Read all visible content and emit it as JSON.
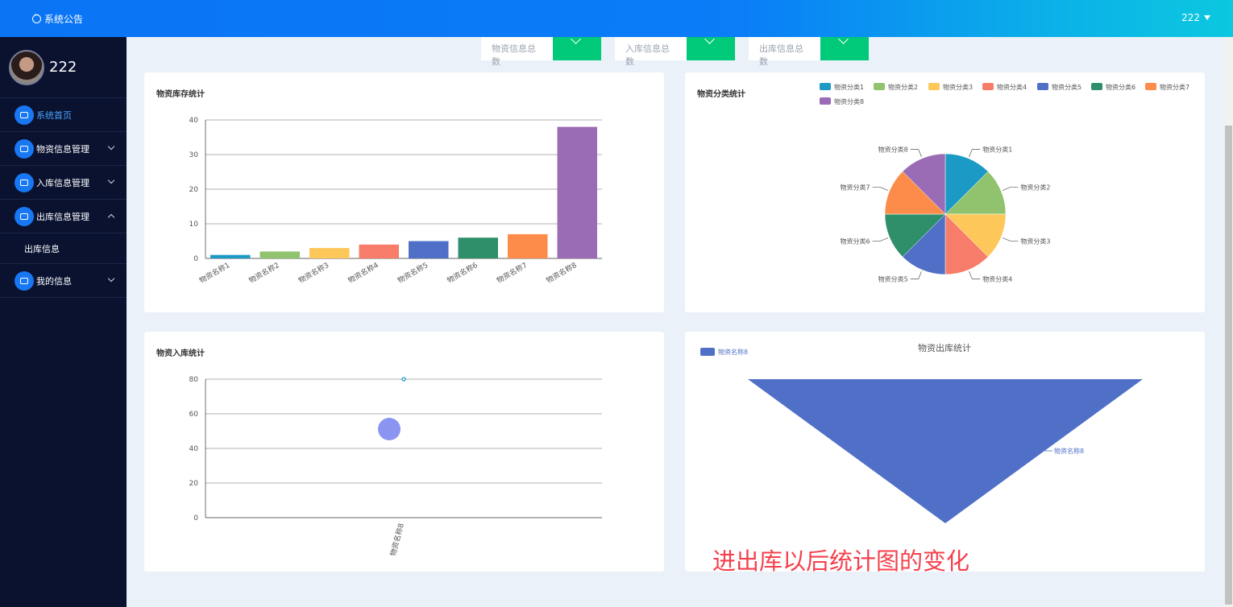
{
  "topbar": {
    "notice": "系统公告",
    "username": "222"
  },
  "sidebar": {
    "profile_name": "222",
    "menu": [
      {
        "label": "系统首页"
      },
      {
        "label": "物资信息管理"
      },
      {
        "label": "入库信息管理"
      },
      {
        "label": "出库信息管理"
      },
      {
        "label": "出库信息"
      },
      {
        "label": "我的信息"
      }
    ]
  },
  "stats": [
    {
      "label": "物资信息总数"
    },
    {
      "label": "入库信息总数"
    },
    {
      "label": "出库信息总数"
    }
  ],
  "cards": {
    "stock": {
      "title": "物资库存统计"
    },
    "category": {
      "title": "物资分类统计"
    },
    "inbound": {
      "title": "物资入库统计"
    },
    "outbound": {
      "title": "物资出库统计"
    }
  },
  "annotation": "进出库以后统计图的变化",
  "chart_data": [
    {
      "type": "bar",
      "title": "物资库存统计",
      "categories": [
        "物资名称1",
        "物资名称2",
        "物资名称3",
        "物资名称4",
        "物资名称5",
        "物资名称6",
        "物资名称7",
        "物资名称8"
      ],
      "values": [
        1,
        2,
        3,
        4,
        5,
        6,
        7,
        38
      ],
      "ylim": [
        0,
        40
      ],
      "yticks": [
        0,
        10,
        20,
        30,
        40
      ],
      "colors": [
        "#1a9ac4",
        "#91c36e",
        "#fdc75a",
        "#f77d6a",
        "#5070c8",
        "#2f8f6b",
        "#fd8c4a",
        "#9a6cb5"
      ],
      "grid": true
    },
    {
      "type": "pie",
      "title": "物资分类统计",
      "categories": [
        "物资分类1",
        "物资分类2",
        "物资分类3",
        "物资分类4",
        "物资分类5",
        "物资分类6",
        "物资分类7",
        "物资分类8"
      ],
      "values": [
        1,
        1,
        1,
        1,
        1,
        1,
        1,
        1
      ],
      "colors": [
        "#1a9ac4",
        "#91c36e",
        "#fdc75a",
        "#f77d6a",
        "#5070c8",
        "#2f8f6b",
        "#fd8c4a",
        "#9a6cb5"
      ],
      "legend": "top-right"
    },
    {
      "type": "line",
      "title": "物资入库统计",
      "categories": [
        "物资名称8"
      ],
      "values": [
        80
      ],
      "ylim": [
        0,
        80
      ],
      "yticks": [
        0,
        20,
        40,
        60,
        80
      ],
      "colors": [
        "#1a9ac4"
      ],
      "grid": true
    },
    {
      "type": "funnel",
      "title": "物资出库统计",
      "categories": [
        "物资名称8"
      ],
      "values": [
        1
      ],
      "colors": [
        "#5070c8"
      ],
      "legend": "top-left"
    }
  ]
}
